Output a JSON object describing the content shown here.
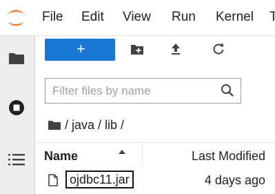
{
  "menubar": {
    "items": [
      "File",
      "Edit",
      "View",
      "Run",
      "Kernel",
      "T"
    ]
  },
  "sidebar": {
    "tabs": [
      "folder-icon",
      "running-icon",
      "toc-icon"
    ]
  },
  "toolbar": {
    "new_label": "+",
    "icons": [
      "new-folder-icon",
      "upload-icon",
      "refresh-icon"
    ],
    "accent": "#1976d2"
  },
  "filter": {
    "placeholder": "Filter files by name"
  },
  "breadcrumb": {
    "path": "/ java / lib /"
  },
  "file_list": {
    "columns": [
      "Name",
      "Last Modified"
    ],
    "rows": [
      {
        "name": "ojdbc11.jar",
        "modified": "4 days ago"
      }
    ]
  }
}
